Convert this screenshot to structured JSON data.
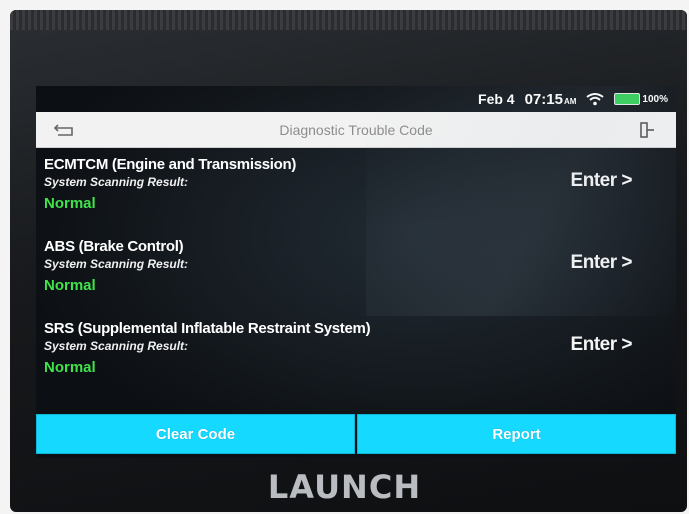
{
  "status_bar": {
    "date": "Feb 4",
    "time": "07:15",
    "ampm": "AM",
    "battery": "100%",
    "battery_color": "#34d058"
  },
  "header": {
    "title": "Diagnostic Trouble Code",
    "back_icon": "back-arrow-icon",
    "exit_icon": "exit-door-icon"
  },
  "systems": [
    {
      "name": "ECMTCM (Engine and Transmission)",
      "scan_label": "System Scanning Result:",
      "result": "Normal",
      "enter_label": "Enter >"
    },
    {
      "name": "ABS (Brake Control)",
      "scan_label": "System Scanning Result:",
      "result": "Normal",
      "enter_label": "Enter >"
    },
    {
      "name": "SRS (Supplemental Inflatable Restraint System)",
      "scan_label": "System Scanning Result:",
      "result": "Normal",
      "enter_label": "Enter >"
    }
  ],
  "actions": {
    "clear_code": "Clear Code",
    "report": "Report",
    "accent": "#16d9ff"
  },
  "result_color": "#3fe34a",
  "brand": "LAUNCH"
}
